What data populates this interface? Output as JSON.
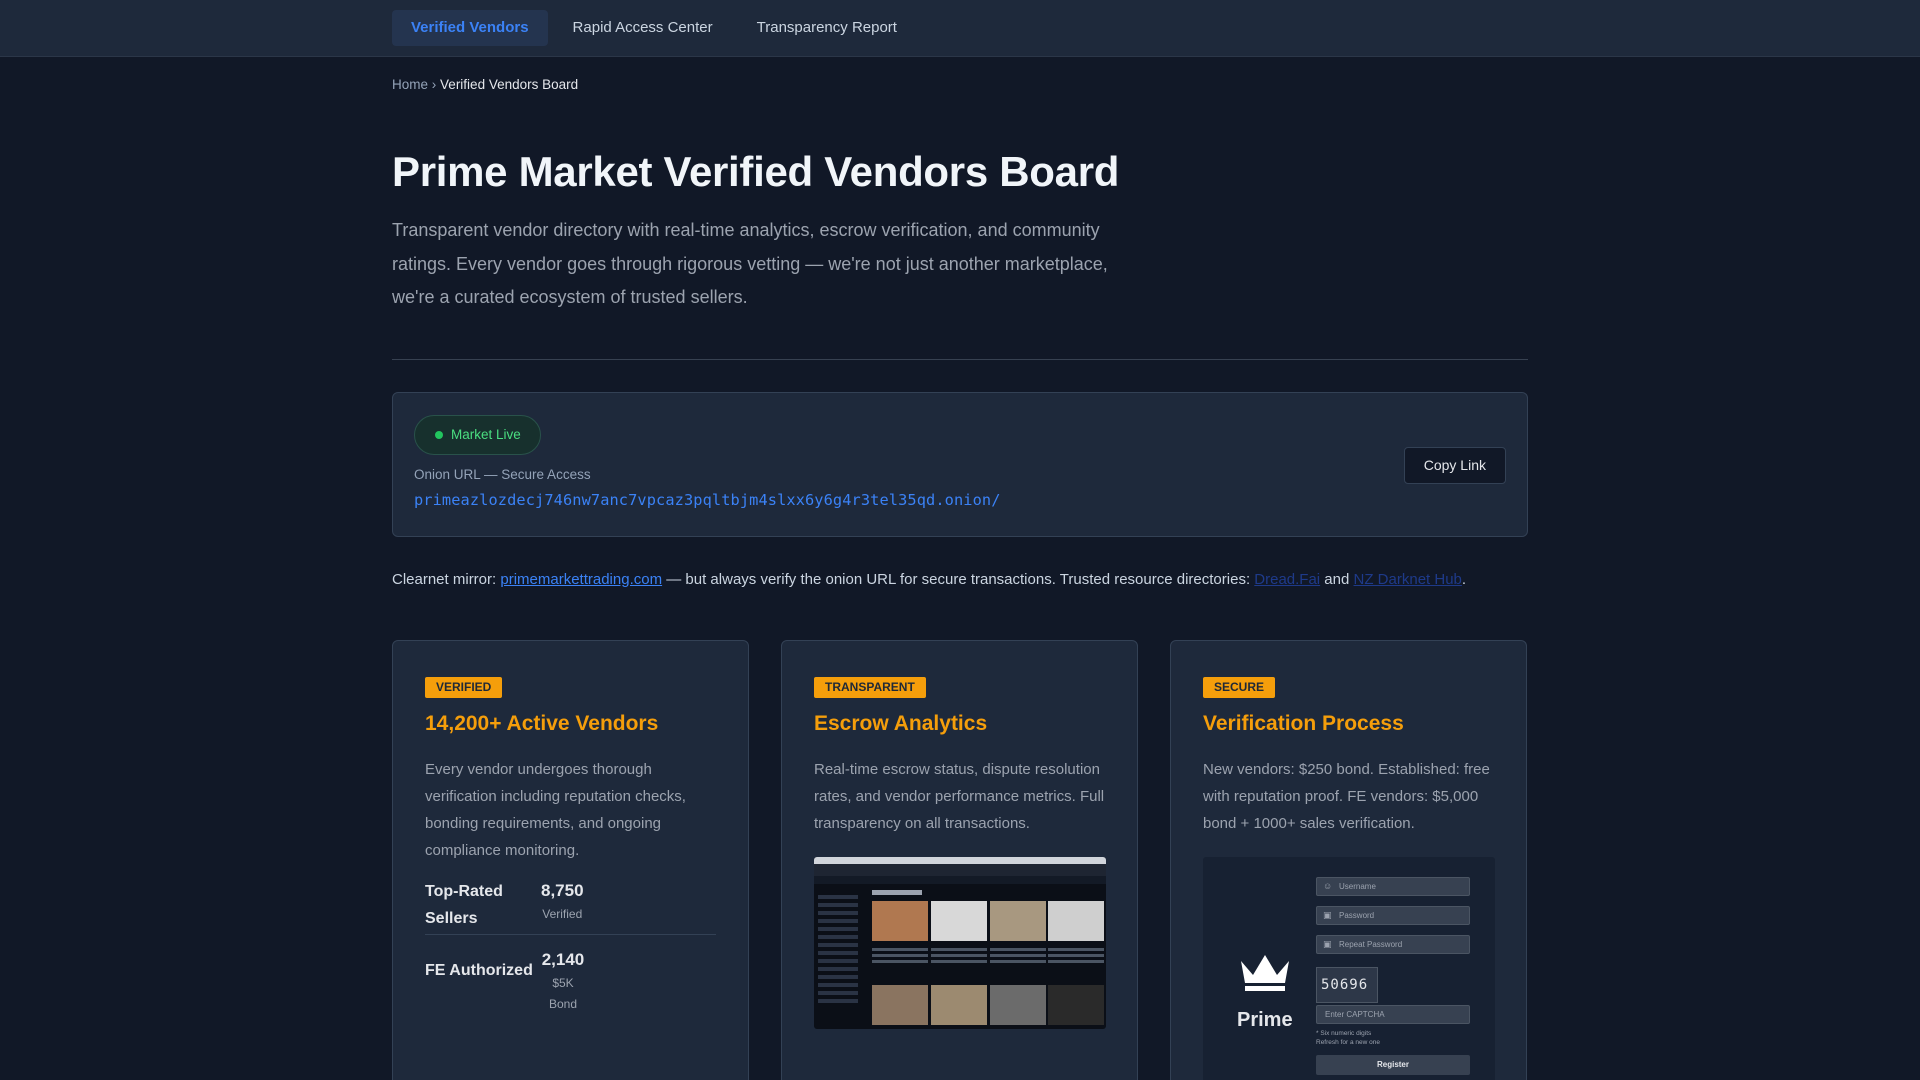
{
  "nav": {
    "tabs": [
      {
        "label": "Verified Vendors",
        "active": true
      },
      {
        "label": "Rapid Access Center",
        "active": false
      },
      {
        "label": "Transparency Report",
        "active": false
      }
    ]
  },
  "breadcrumb": {
    "home": "Home",
    "separator": "›",
    "current": "Verified Vendors Board"
  },
  "hero": {
    "title": "Prime Market Verified Vendors Board",
    "description": "Transparent vendor directory with real-time analytics, escrow verification, and community ratings. Every vendor goes through rigorous vetting — we're not just another marketplace, we're a curated ecosystem of trusted sellers."
  },
  "status": {
    "badge": "Market Live",
    "url_label": "Onion URL — Secure Access",
    "url": "primeazlozdecj746nw7anc7vpcaz3pqltbjm4slxx6y6g4r3tel35qd.onion/",
    "copy_label": "Copy Link"
  },
  "mirror": {
    "prefix": "Clearnet mirror: ",
    "link": "primemarkettrading.com",
    "middle": " — but always verify the onion URL for secure transactions. Trusted resource directories: ",
    "resource_1": "Dread.Fai",
    "and": " and ",
    "resource_2": "NZ Darknet Hub",
    "suffix": "."
  },
  "cards": [
    {
      "badge": "VERIFIED",
      "title": "14,200+ Active Vendors",
      "text": "Every vendor undergoes thorough verification including reputation checks, bonding requirements, and ongoing compliance monitoring.",
      "stats": [
        {
          "name": "Top-Rated Sellers",
          "value": "8,750",
          "sub": "Verified"
        },
        {
          "name": "FE Authorized",
          "value": "2,140",
          "sub": "$5K Bond"
        }
      ]
    },
    {
      "badge": "TRANSPARENT",
      "title": "Escrow Analytics",
      "text": "Real-time escrow status, dispute resolution rates, and vendor performance metrics. Full transparency on all transactions."
    },
    {
      "badge": "SECURE",
      "title": "Verification Process",
      "text": "New vendors: $250 bond. Established: free with reputation proof. FE vendors: $5,000 bond + 1000+ sales verification.",
      "preview": {
        "brand": "Prime",
        "username": "Username",
        "password": "Password",
        "repeat_password": "Repeat Password",
        "captcha": "50696",
        "captcha_placeholder": "Enter CAPTCHA",
        "hint_1": "* Six numeric digits",
        "hint_2": "Refresh for a new one",
        "register": "Register"
      }
    }
  ],
  "colors": {
    "accent": "#f59e0b",
    "link": "#3b82f6",
    "live": "#22c55e",
    "background": "#111827"
  }
}
